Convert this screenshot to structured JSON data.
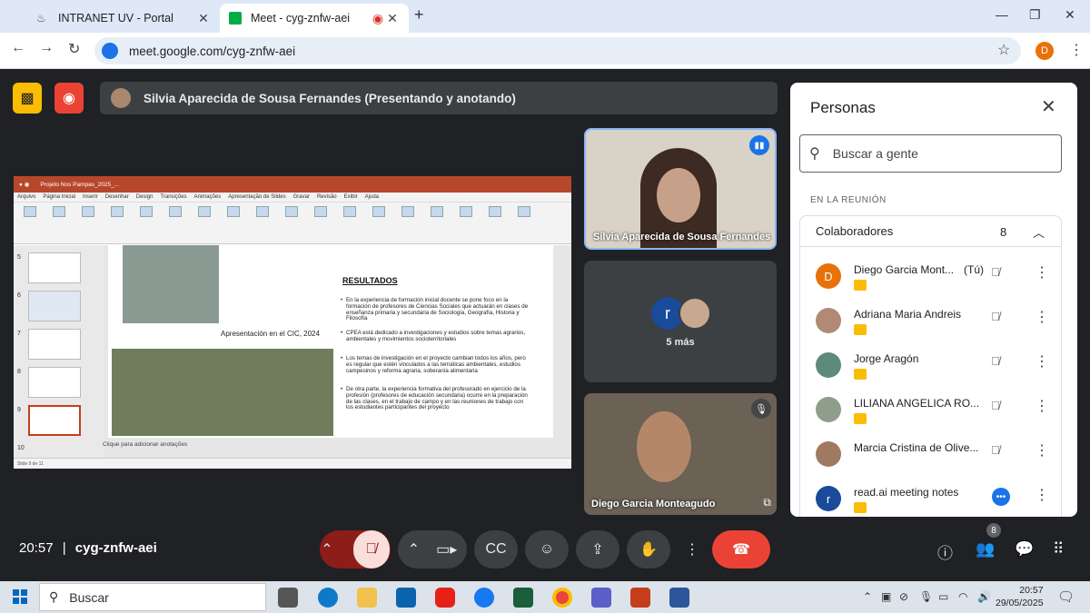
{
  "browser": {
    "tabs": [
      {
        "title": "INTRANET UV - Portal"
      },
      {
        "title": "Meet - cyg-znfw-aei"
      }
    ],
    "url": "meet.google.com/cyg-znfw-aei",
    "profile_initial": "D"
  },
  "meet": {
    "presenter_banner": "Silvia Aparecida de Sousa Fernandes (Presentando y anotando)",
    "slides": {
      "title_bar": "Projeto Nos Pampas_2025_...",
      "menu": [
        "Arquivo",
        "Página Inicial",
        "Inserir",
        "Desenhar",
        "Design",
        "Transições",
        "Animações",
        "Apresentação de Slides",
        "Gravar",
        "Revisão",
        "Exibir",
        "Ajuda"
      ],
      "thumb_numbers": [
        "5",
        "6",
        "7",
        "8",
        "9",
        "10"
      ],
      "slide_title": "RESULTADOS",
      "caption": "Apresentación en el CIC, 2024",
      "bullets": [
        "En la experiencia de formación inicial docente se pone foco en la formación de profesores de Ciencias Sociales que actuarán en clases de enseñanza primaria y secundaria de Sociología, Geografía, Historia y Filosofía",
        "CPEA está dedicado a investigaciones y estudios sobre temas agrarios, ambientales y movimientos socioterritoriales",
        "Los temas de investigación en el proyecto cambian todos los años, pero es regular que estén vinculados a las temáticas ambientales, estudios campesinos y reforma agraria, soberanía alimentaria",
        "De otra parte, la experiencia formativa del profesorado en ejercicio de la profesión (profesores de educación secundaria) ocurre en la preparación de las clases, en el trabajo de campo y en las reuniones de trabajo con los estudiantes participantes del proyecto"
      ],
      "notes": "Clique para adicionar anotações",
      "status": "Slide 9 de 11"
    },
    "tiles": {
      "tile1_name": "Silvia Aparecida de Sousa Fernandes",
      "more_label": "5 más",
      "more_initial": "r",
      "tile3_name": "Diego Garcia Monteagudo"
    },
    "clock": "20:57",
    "meeting_code": "cyg-znfw-aei",
    "people_badge": "8"
  },
  "people": {
    "title": "Personas",
    "search_placeholder": "Buscar a gente",
    "section": "EN LA REUNIÓN",
    "group_label": "Colaboradores",
    "group_count": "8",
    "list": [
      {
        "initial": "D",
        "name": "Diego Garcia Mont...",
        "you": "(Tú)",
        "color": "#e8710a"
      },
      {
        "initial": "",
        "name": "Adriana Maria Andreis",
        "you": "",
        "color": "#b08a74"
      },
      {
        "initial": "",
        "name": "Jorge Aragón",
        "you": "",
        "color": "#5d8a7a"
      },
      {
        "initial": "",
        "name": "LILIANA ANGELICA RO...",
        "you": "",
        "color": "#8e9e8a"
      },
      {
        "initial": "",
        "name": "Marcia Cristina de Olive...",
        "you": "",
        "color": "#a07a60"
      },
      {
        "initial": "r",
        "name": "read.ai meeting notes",
        "you": "",
        "color": "#1a4a9a"
      }
    ]
  },
  "taskbar": {
    "search": "Buscar",
    "time": "20:57",
    "date": "29/05/2025"
  },
  "colors": {
    "meet_bg": "#202124",
    "accent": "#1a73e8",
    "leave_red": "#ea4335"
  }
}
